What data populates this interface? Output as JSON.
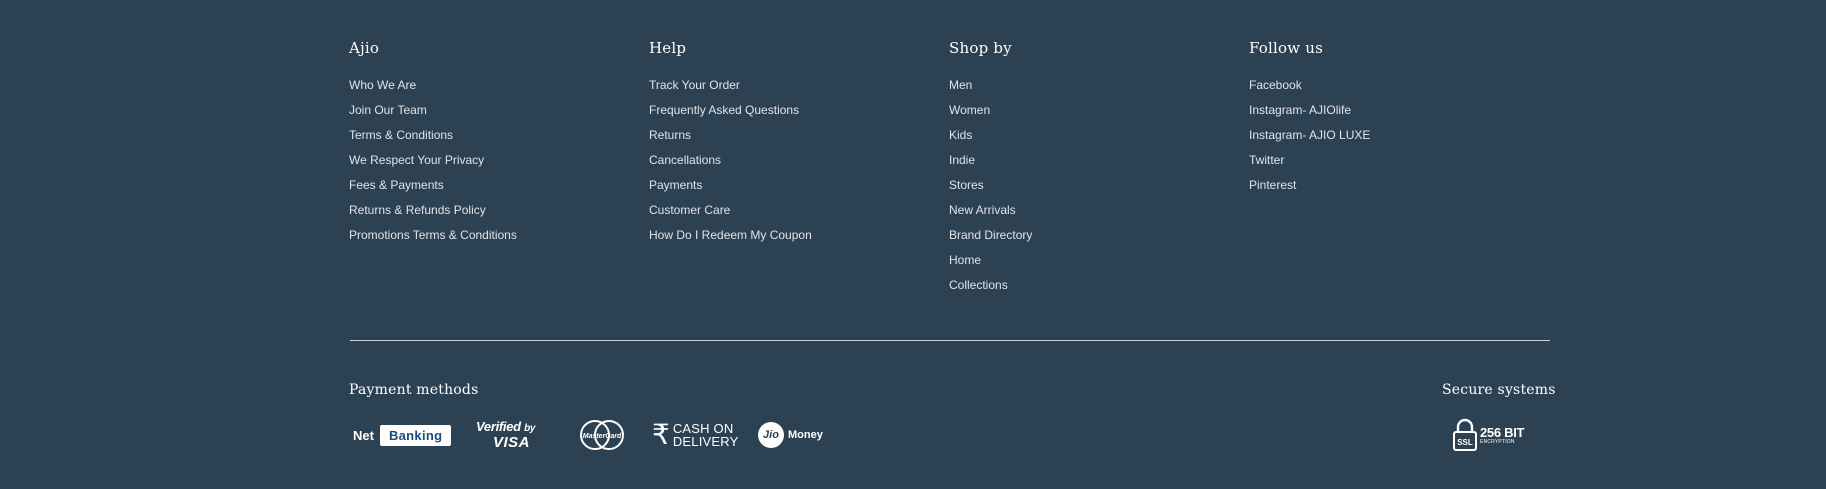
{
  "columns": [
    {
      "title": "Ajio",
      "links": [
        "Who We Are",
        "Join Our Team",
        "Terms & Conditions",
        "We Respect Your Privacy",
        "Fees & Payments",
        "Returns & Refunds Policy",
        "Promotions Terms & Conditions"
      ]
    },
    {
      "title": "Help",
      "links": [
        "Track Your Order",
        "Frequently Asked Questions",
        "Returns",
        "Cancellations",
        "Payments",
        "Customer Care",
        "How Do I Redeem My Coupon"
      ]
    },
    {
      "title": "Shop by",
      "links": [
        "Men",
        "Women",
        "Kids",
        "Indie",
        "Stores",
        "New Arrivals",
        "Brand Directory",
        "Home",
        "Collections"
      ]
    },
    {
      "title": "Follow us",
      "links": [
        "Facebook",
        "Instagram- AJIOlife",
        "Instagram- AJIO LUXE",
        "Twitter",
        "Pinterest"
      ]
    }
  ],
  "payment": {
    "title": "Payment methods",
    "netbanking": {
      "net": "Net",
      "banking": "Banking"
    },
    "visa": {
      "verified": "Verified",
      "by": "by",
      "visa": "VISA"
    },
    "mastercard": {
      "label": "MasterCard"
    },
    "cod": {
      "icon": "rupee-icon",
      "line1": "CASH ON",
      "line2": "DELIVERY"
    },
    "jio": {
      "jio": "Jio",
      "money": "Money"
    }
  },
  "secure": {
    "title": "Secure systems",
    "ssl_label": "SSL",
    "bits": "256 BIT",
    "encryption": "ENCRYPTION"
  },
  "colors": {
    "background": "#2c4152",
    "text": "#dfe5ea",
    "heading": "#ffffff",
    "divider": "#c8d1d8"
  }
}
